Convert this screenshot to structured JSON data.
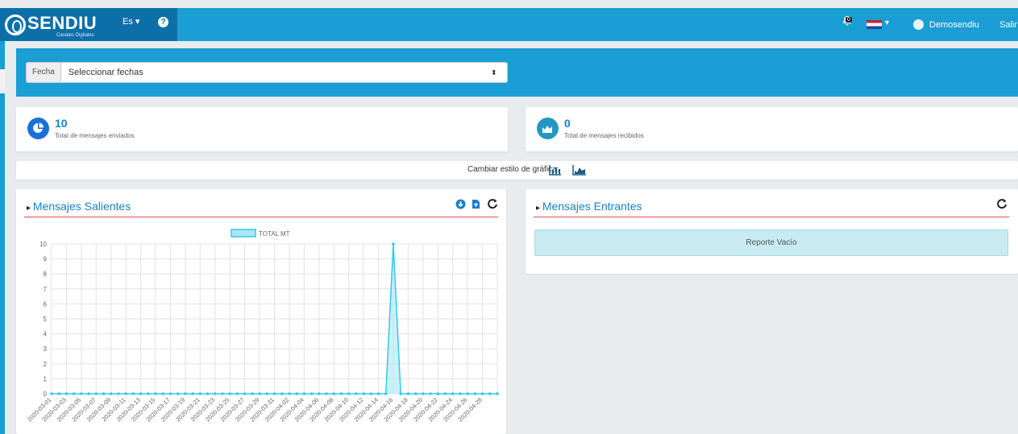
{
  "header": {
    "brand": "SENDIU",
    "brand_sub": "Canales Digitales",
    "language": "Es ▾",
    "help": "?",
    "notification_count": "0",
    "user_name": "Demosendiu",
    "logout": "Salir"
  },
  "filter": {
    "label": "Fecha",
    "placeholder": "Seleccionar fechas"
  },
  "stats": {
    "sent_count": "10",
    "sent_label": "Total de mensajes enviados",
    "received_count": "0",
    "received_label": "Total de mensajes recibidos"
  },
  "chart_style": {
    "label": "Cambiar estilo de gráfica:"
  },
  "panels": {
    "outgoing_title": "Mensajes Salientes",
    "incoming_title": "Mensajes Entrantes",
    "empty_report": "Reporte Vacío"
  },
  "colors": {
    "primary": "#1a9ed4",
    "title": "#1a7fc9",
    "accent_line": "#e04848",
    "chart_line": "#36c8ea",
    "chart_fill": "#a9e8f6"
  },
  "chart_data": {
    "type": "area",
    "legend": "TOTAL MT",
    "ylim": [
      0,
      10
    ],
    "yticks": [
      0,
      1,
      2,
      3,
      4,
      5,
      6,
      7,
      8,
      9,
      10
    ],
    "x": [
      "2020-03-01",
      "2020-03-02",
      "2020-03-03",
      "2020-03-04",
      "2020-03-05",
      "2020-03-06",
      "2020-03-07",
      "2020-03-08",
      "2020-03-09",
      "2020-03-10",
      "2020-03-11",
      "2020-03-12",
      "2020-03-13",
      "2020-03-14",
      "2020-03-15",
      "2020-03-16",
      "2020-03-17",
      "2020-03-18",
      "2020-03-19",
      "2020-03-20",
      "2020-03-21",
      "2020-03-22",
      "2020-03-23",
      "2020-03-24",
      "2020-03-25",
      "2020-03-26",
      "2020-03-27",
      "2020-03-28",
      "2020-03-29",
      "2020-03-30",
      "2020-03-31",
      "2020-04-01",
      "2020-04-02",
      "2020-04-03",
      "2020-04-04",
      "2020-04-05",
      "2020-04-06",
      "2020-04-07",
      "2020-04-08",
      "2020-04-09",
      "2020-04-10",
      "2020-04-11",
      "2020-04-12",
      "2020-04-13",
      "2020-04-14",
      "2020-04-15",
      "2020-04-16",
      "2020-04-17",
      "2020-04-18",
      "2020-04-19",
      "2020-04-20",
      "2020-04-21",
      "2020-04-22",
      "2020-04-23",
      "2020-04-24",
      "2020-04-25",
      "2020-04-26",
      "2020-04-27",
      "2020-04-28",
      "2020-04-29",
      "2020-04-30"
    ],
    "xtick_labels": [
      "2020-03-01",
      "2020-03-03",
      "2020-03-05",
      "2020-03-07",
      "2020-03-09",
      "2020-03-11",
      "2020-03-13",
      "2020-03-15",
      "2020-03-17",
      "2020-03-19",
      "2020-03-21",
      "2020-03-23",
      "2020-03-25",
      "2020-03-27",
      "2020-03-29",
      "2020-03-31",
      "2020-04-02",
      "2020-04-04",
      "2020-04-06",
      "2020-04-08",
      "2020-04-10",
      "2020-04-12",
      "2020-04-14",
      "2020-04-16",
      "2020-04-18",
      "2020-04-20",
      "2020-04-22",
      "2020-04-24",
      "2020-04-26",
      "2020-04-28"
    ],
    "series": [
      {
        "name": "TOTAL MT",
        "values": [
          0,
          0,
          0,
          0,
          0,
          0,
          0,
          0,
          0,
          0,
          0,
          0,
          0,
          0,
          0,
          0,
          0,
          0,
          0,
          0,
          0,
          0,
          0,
          0,
          0,
          0,
          0,
          0,
          0,
          0,
          0,
          0,
          0,
          0,
          0,
          0,
          0,
          0,
          0,
          0,
          0,
          0,
          0,
          0,
          0,
          0,
          10,
          0,
          0,
          0,
          0,
          0,
          0,
          0,
          0,
          0,
          0,
          0,
          0,
          0,
          0
        ]
      }
    ]
  }
}
